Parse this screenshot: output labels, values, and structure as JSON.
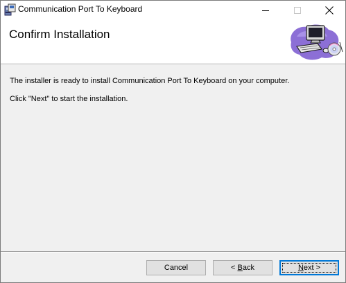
{
  "window": {
    "title": "Communication Port To Keyboard",
    "icon": "installer-package-icon",
    "controls": {
      "minimize": "minimize-icon",
      "maximize": "maximize-icon",
      "close": "close-icon"
    }
  },
  "banner": {
    "title": "Confirm Installation",
    "art": "computer-with-disc-icon"
  },
  "body": {
    "line1": "The installer is ready to install Communication Port To Keyboard on your computer.",
    "line2": "Click \"Next\" to start the installation."
  },
  "buttons": {
    "cancel": "Cancel",
    "back": {
      "prefix": "< ",
      "accel": "B",
      "rest": "ack"
    },
    "next": {
      "accel": "N",
      "rest": "ext >"
    }
  },
  "colors": {
    "focus_border": "#0078d7",
    "dialog_bg": "#f0f0f0",
    "banner_bg": "#ffffff"
  }
}
